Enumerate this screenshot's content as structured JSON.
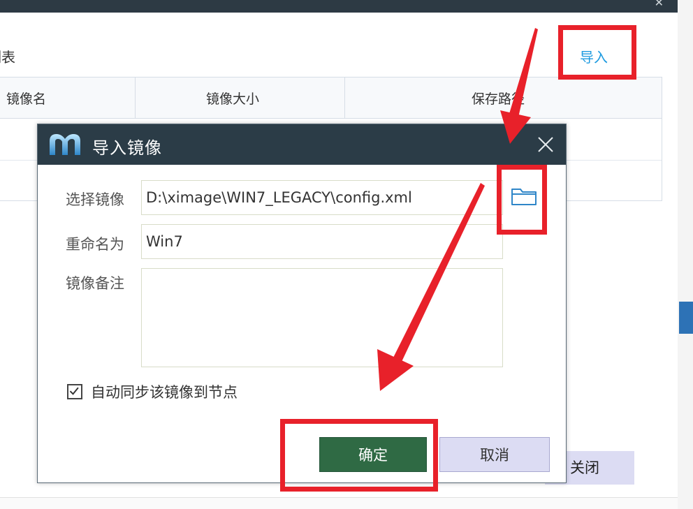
{
  "background": {
    "heading": "列表",
    "import_link": "导入",
    "table_headers": [
      "镜像名",
      "镜像大小",
      "保存路径"
    ],
    "close_button": "关闭"
  },
  "dialog": {
    "title": "导入镜像",
    "fields": {
      "image_label": "选择镜像",
      "image_value": "D:\\ximage\\WIN7_LEGACY\\config.xml",
      "rename_label": "重命名为",
      "rename_value": "Win7",
      "remark_label": "镜像备注",
      "remark_value": ""
    },
    "auto_sync_label": "自动同步该镜像到节点",
    "auto_sync_checked": true,
    "ok_button": "确定",
    "cancel_button": "取消"
  },
  "colors": {
    "titlebar": "#2b3c47",
    "ok_button": "#2f6a44",
    "cancel_button": "#dcdcf3",
    "accent_link": "#1e9be0",
    "annotation_red": "#e8212a"
  }
}
